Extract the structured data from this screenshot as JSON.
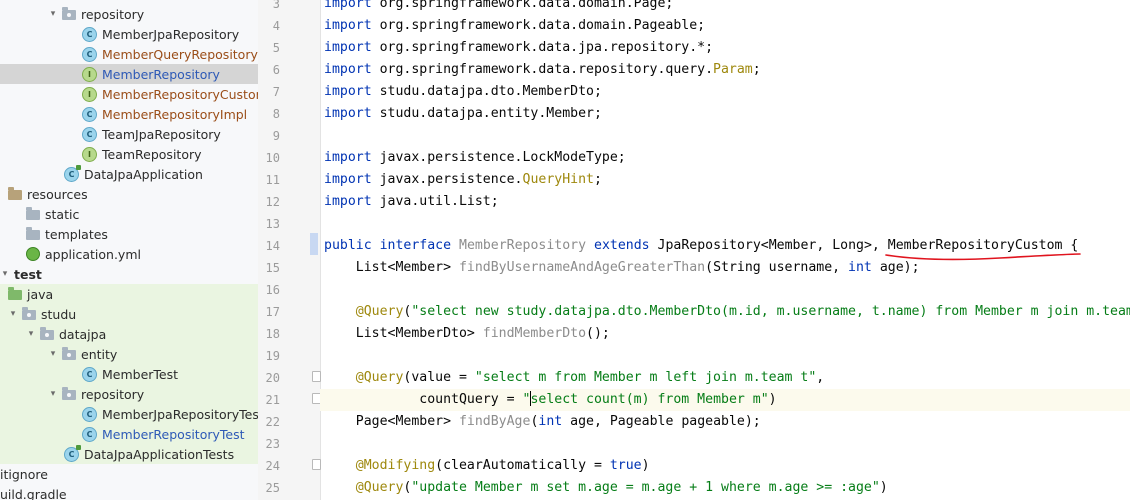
{
  "tree": {
    "items": [
      {
        "label": "repository",
        "type": "package-folder",
        "arrow": "▾"
      },
      {
        "label": "MemberJpaRepository",
        "type": "class"
      },
      {
        "label": "MemberQueryRepository",
        "type": "class",
        "modified": true
      },
      {
        "label": "MemberRepository",
        "type": "interface",
        "selected": true
      },
      {
        "label": "MemberRepositoryCustom",
        "type": "interface",
        "modified": true
      },
      {
        "label": "MemberRepositoryImpl",
        "type": "class",
        "modified": true
      },
      {
        "label": "TeamJpaRepository",
        "type": "class"
      },
      {
        "label": "TeamRepository",
        "type": "interface"
      },
      {
        "label": "DataJpaApplication",
        "type": "class-run"
      },
      {
        "label": "resources",
        "type": "resources-folder"
      },
      {
        "label": "static",
        "type": "folder"
      },
      {
        "label": "templates",
        "type": "folder"
      },
      {
        "label": "application.yml",
        "type": "yml"
      },
      {
        "label": "test",
        "type": "folder",
        "arrow": "▾",
        "bold": true
      },
      {
        "label": "java",
        "type": "source-folder"
      },
      {
        "label": "studu",
        "type": "package-folder",
        "arrow": "▾"
      },
      {
        "label": "datajpa",
        "type": "package-folder",
        "arrow": "▾"
      },
      {
        "label": "entity",
        "type": "package-folder",
        "arrow": "▾"
      },
      {
        "label": "MemberTest",
        "type": "class"
      },
      {
        "label": "repository",
        "type": "package-folder",
        "arrow": "▾"
      },
      {
        "label": "MemberJpaRepositoryTest",
        "type": "class"
      },
      {
        "label": "MemberRepositoryTest",
        "type": "class",
        "blue": true
      },
      {
        "label": "DataJpaApplicationTests",
        "type": "class-run"
      },
      {
        "label": "itignore",
        "type": "file"
      },
      {
        "label": "uild.gradle",
        "type": "gradle"
      }
    ]
  },
  "editor": {
    "line_numbers": [
      "3",
      "4",
      "5",
      "6",
      "7",
      "8",
      "9",
      "10",
      "11",
      "12",
      "13",
      "14",
      "15",
      "16",
      "17",
      "18",
      "19",
      "20",
      "21",
      "22",
      "23",
      "24",
      "25"
    ],
    "lines": {
      "l3": {
        "kw": "import",
        "rest": " org.springframework.data.domain.Page;"
      },
      "l4": {
        "kw": "import",
        "rest": " org.springframework.data.domain.Pageable;"
      },
      "l5": {
        "kw": "import",
        "rest": " org.springframework.data.jpa.repository.*;"
      },
      "l6": {
        "kw": "import",
        "rest": " org.springframework.data.repository.query.",
        "ann": "Param",
        "end": ";"
      },
      "l7": {
        "kw": "import",
        "rest": " studu.datajpa.dto.MemberDto;"
      },
      "l8": {
        "kw": "import",
        "rest": " studu.datajpa.entity.Member;"
      },
      "l10": {
        "kw": "import",
        "rest": " javax.persistence.LockModeType;"
      },
      "l11": {
        "kw": "import",
        "rest": " javax.persistence.",
        "ann": "QueryHint",
        "end": ";"
      },
      "l12": {
        "kw": "import",
        "rest": " java.util.List;"
      },
      "l14": {
        "kw1": "public",
        "kw2": "interface",
        "name": "MemberRepository",
        "kw3": "extends",
        "rest": "JpaRepository<Member, Long>, MemberRepositoryCustom {"
      },
      "l15": {
        "pre": "    List<Member> ",
        "fn": "findByUsernameAndAgeGreaterThan",
        "mid": "(String username, ",
        "kw": "int",
        "end": " age);"
      },
      "l17": {
        "pre": "    ",
        "ann": "@Query",
        "p1": "(",
        "str": "\"select new study.datajpa.dto.MemberDto(m.id, m.username, t.name) from Member m join m.team t\"",
        "end": ")"
      },
      "l18": {
        "pre": "    List<MemberDto> ",
        "fn": "findMemberDto",
        "end": "();"
      },
      "l20": {
        "pre": "    ",
        "ann": "@Query",
        "mid": "(value = ",
        "str": "\"select m from Member m left join m.team t\"",
        "end": ","
      },
      "l21": {
        "pre": "            countQuery = ",
        "str1": "\"",
        "str2": "select count(m) from Member m\"",
        "end": ")"
      },
      "l22": {
        "pre": "    Page<Member> ",
        "fn": "findByAge",
        "p1": "(",
        "kw": "int",
        "end": " age, Pageable pageable);"
      },
      "l24": {
        "pre": "    ",
        "ann": "@Modifying",
        "mid": "(clearAutomatically = ",
        "kw": "true",
        "end": ")"
      },
      "l25": {
        "pre": "    ",
        "ann": "@Query",
        "p1": "(",
        "str": "\"update Member m set m.age = m.age + 1 where m.age >= :age\"",
        "end": ")"
      }
    }
  },
  "colors": {
    "keyword": "#0033b3",
    "annotation": "#9e880d",
    "string": "#067d17",
    "unused": "#8c8c8c",
    "method": "#00627a",
    "underline": "#e0141e",
    "test_highlight": "#eaf5e1"
  }
}
